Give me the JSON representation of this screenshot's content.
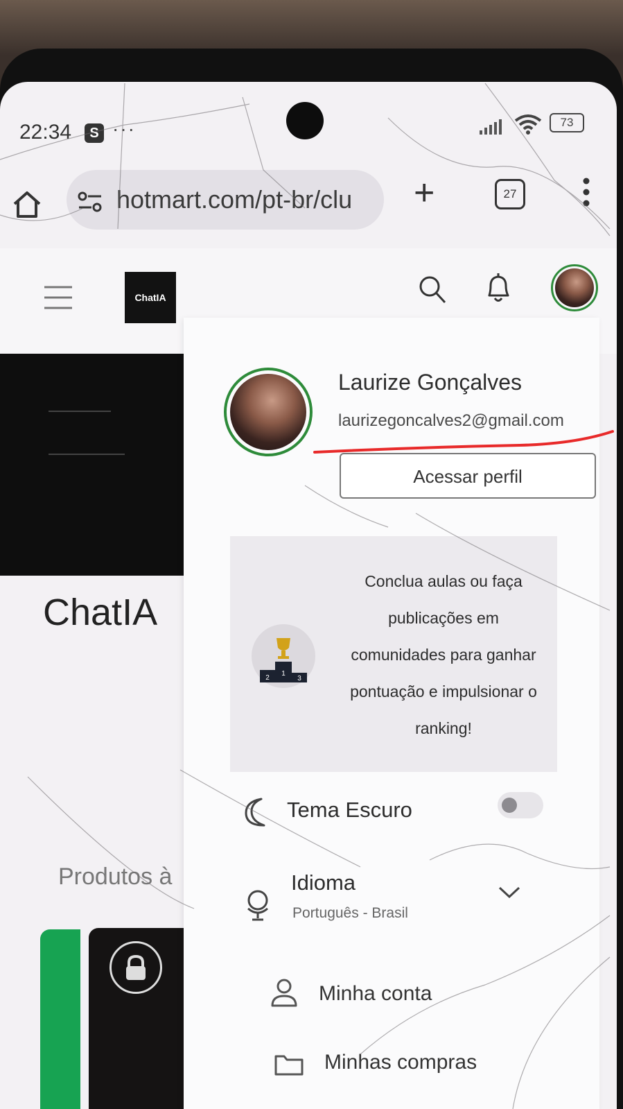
{
  "status_bar": {
    "time": "22:34",
    "app_badge": "S",
    "more": "···",
    "battery": "73"
  },
  "browser": {
    "url": "hotmart.com/pt-br/clu",
    "new_tab": "+",
    "tab_count": "27"
  },
  "site": {
    "logo_text": "ChatIA",
    "page_title": "ChatIA",
    "products_heading": "Produtos à"
  },
  "profile_menu": {
    "user_name": "Laurize Gonçalves",
    "user_email": "laurizegoncalves2@gmail.com",
    "profile_button": "Acessar perfil",
    "ranking_message": "Conclua aulas ou faça publicações em comunidades para ganhar pontuação e impulsionar o ranking!",
    "podium_places": [
      "2",
      "1",
      "3"
    ],
    "dark_theme_label": "Tema Escuro",
    "dark_theme_enabled": false,
    "language_label": "Idioma",
    "language_value": "Português - Brasil",
    "my_account_label": "Minha conta",
    "my_purchases_label": "Minhas compras"
  },
  "colors": {
    "avatar_ring": "#2e8b3a",
    "annotation_underline": "#e82a2a",
    "card_green": "#17a352"
  },
  "icons": {
    "home": "home-icon",
    "url_settings": "tune-icon",
    "browser_menu": "kebab-icon",
    "hamburger": "hamburger-icon",
    "search": "search-icon",
    "notifications": "bell-icon",
    "trophy": "trophy-podium-icon",
    "dark_theme": "moon-icon",
    "language": "globe-icon",
    "expand": "chevron-down-icon",
    "account": "person-icon",
    "purchases": "folder-icon",
    "locked": "lock-icon"
  }
}
